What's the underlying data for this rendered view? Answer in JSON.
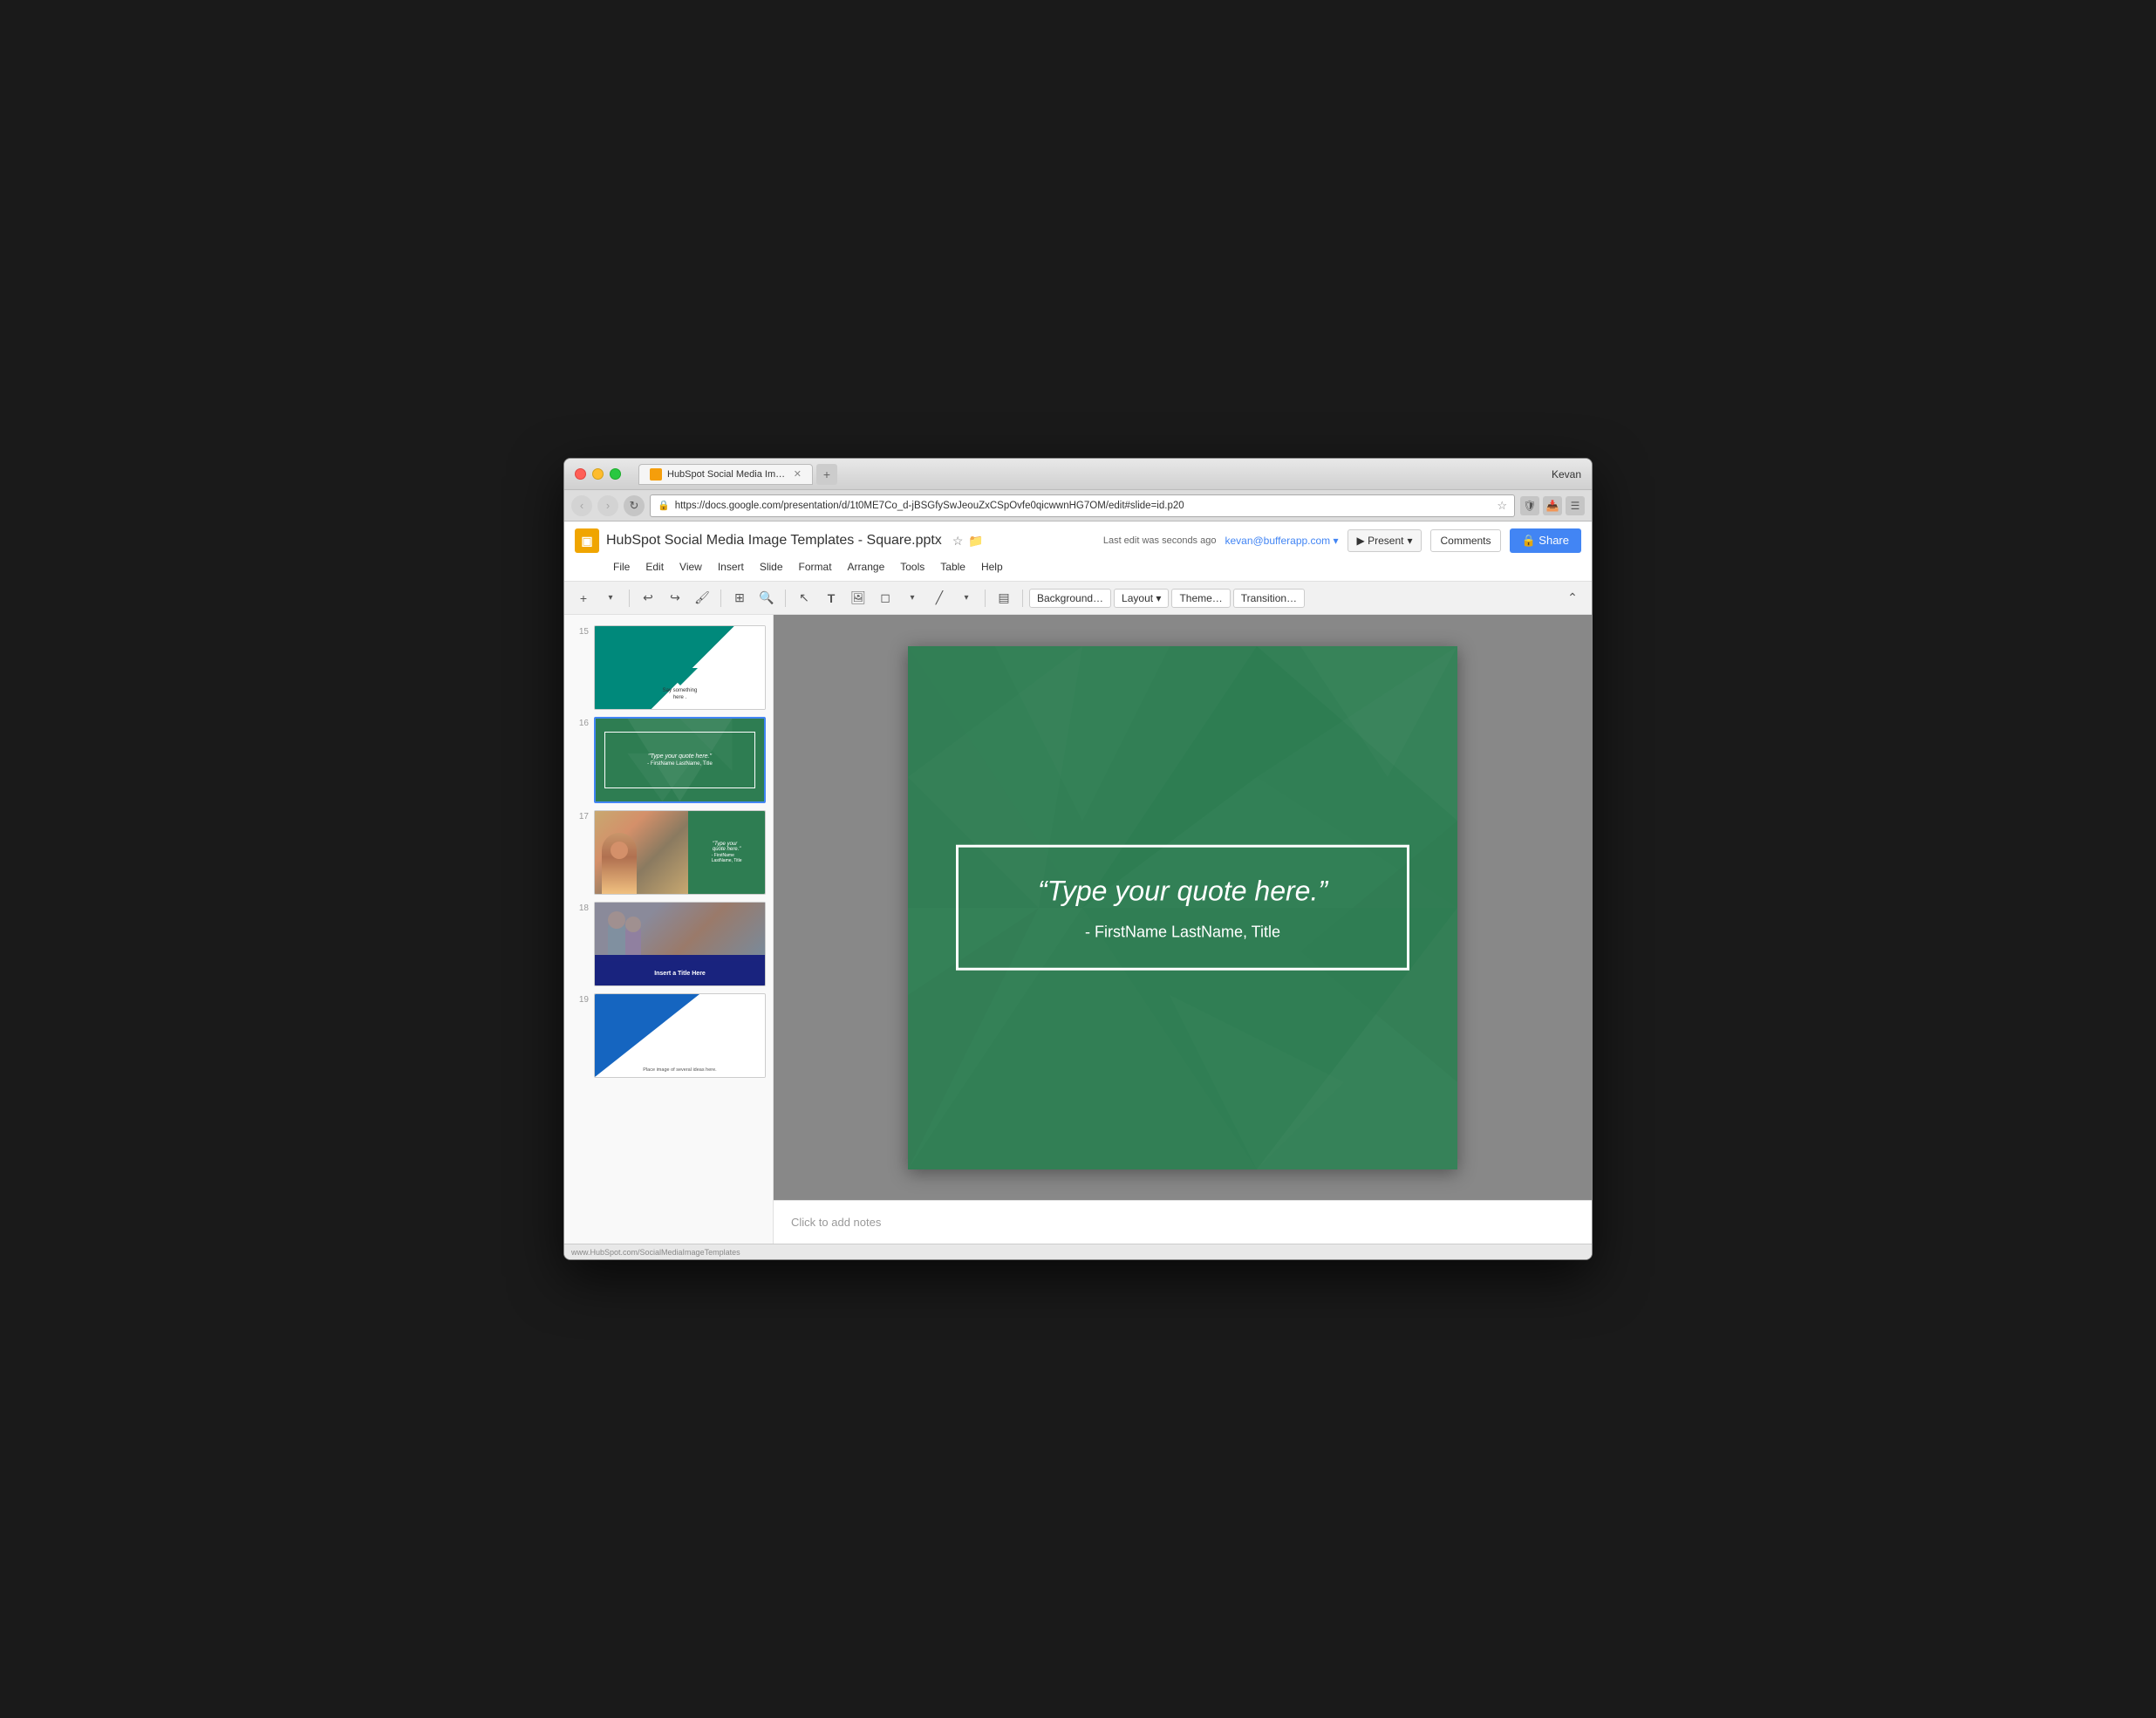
{
  "browser": {
    "user": "Kevan",
    "tab_title": "HubSpot Social Media Ima…",
    "tab_favicon": "slides",
    "url": "https://docs.google.com/presentation/d/1t0ME7Co_d-jBSGfySwJeouZxCSpOvfe0qicwwnHG7OM/edit#slide=id.p20",
    "nav": {
      "back": "‹",
      "forward": "›",
      "reload": "↻"
    }
  },
  "slides_app": {
    "logo": "▣",
    "doc_title": "HubSpot Social Media Image Templates - Square.pptx",
    "star_icon": "☆",
    "folder_icon": "📁",
    "user_email": "kevan@bufferapp.com ▾",
    "last_edit": "Last edit was seconds ago",
    "buttons": {
      "present": "▶ Present",
      "present_dropdown": "▾",
      "comments": "Comments",
      "share": "🔒 Share"
    },
    "menu": [
      "File",
      "Edit",
      "View",
      "Insert",
      "Slide",
      "Format",
      "Arrange",
      "Tools",
      "Table",
      "Help"
    ]
  },
  "toolbar": {
    "add": "+",
    "add_dropdown": "▾",
    "undo": "↩",
    "redo": "↪",
    "paint_format": "🖌",
    "zoom_fit": "⊞",
    "zoom": "🔍",
    "select": "↖",
    "text": "T",
    "image": "🖼",
    "shape": "◻",
    "line": "╱",
    "separator1": "",
    "text_box": "▤",
    "background": "Background…",
    "layout": "Layout ▾",
    "theme": "Theme…",
    "transition": "Transition…",
    "collapse": "⌃"
  },
  "slides": [
    {
      "number": "15",
      "type": "say-something",
      "active": false,
      "text": "Say something here ."
    },
    {
      "number": "16",
      "type": "quote-green",
      "active": true,
      "text": "Type your quote here.",
      "attr": "FirstName LastName, Title"
    },
    {
      "number": "17",
      "type": "quote-photo",
      "active": false,
      "text": "Type your quote here.",
      "attr": "FirstName LastName, Title"
    },
    {
      "number": "18",
      "type": "insert-title",
      "active": false,
      "text": "Insert a Title Here"
    },
    {
      "number": "19",
      "type": "triangle-blue",
      "active": false,
      "text": "Place image of several ideas here."
    }
  ],
  "active_slide": {
    "quote": "“Type your quote here.”",
    "attribution": "- FirstName LastName, Title"
  },
  "notes": {
    "placeholder": "Click to add notes"
  },
  "status_bar": {
    "url": "www.HubSpot.com/SocialMediaImageTemplates"
  }
}
